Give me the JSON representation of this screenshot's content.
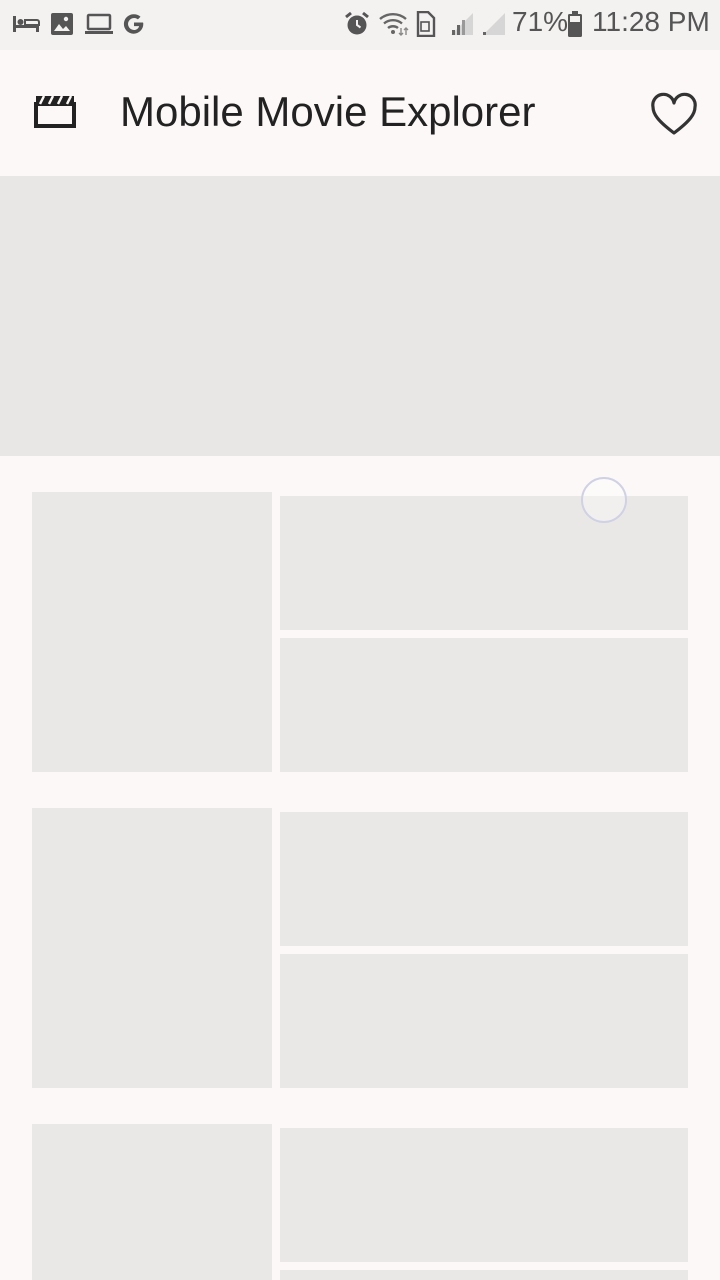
{
  "status_bar": {
    "battery_percent": "71%",
    "time": "11:28 PM",
    "left_icons": [
      "bed-icon",
      "image-icon",
      "laptop-icon",
      "google-icon"
    ],
    "right_icons": [
      "alarm-icon",
      "wifi-icon",
      "sim-icon",
      "signal-icon",
      "signal-icon",
      "battery-icon"
    ]
  },
  "app_bar": {
    "title": "Mobile Movie Explorer",
    "logo_icon": "clapperboard-icon",
    "action_icon": "heart-outline-icon"
  },
  "content": {
    "state": "loading",
    "placeholder_color": "#eae8e7",
    "hero_color": "#e9e7e6",
    "list_rows": 3
  }
}
